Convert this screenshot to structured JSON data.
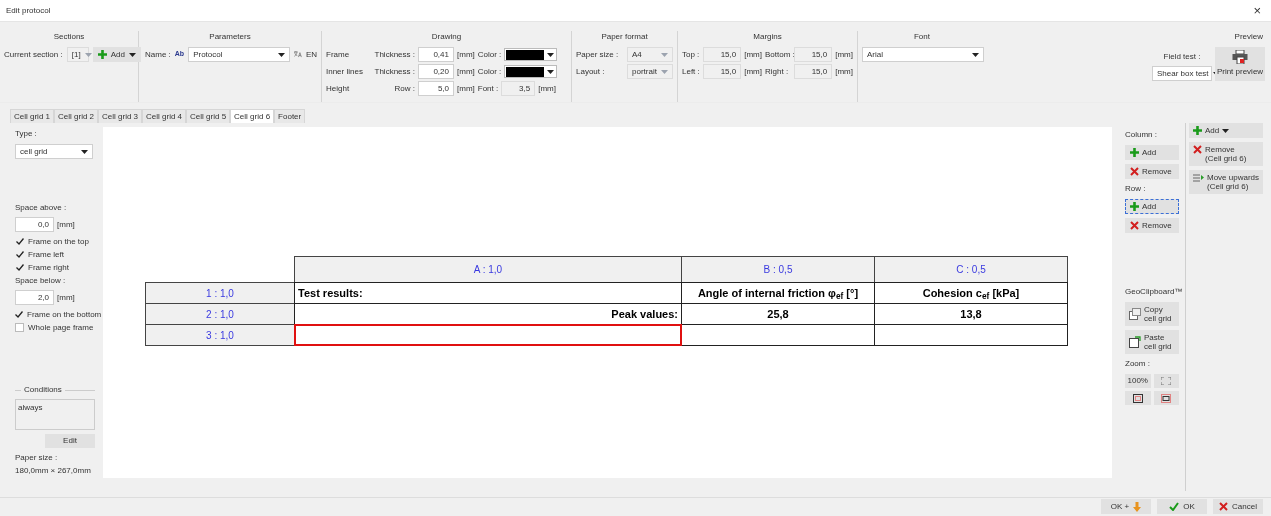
{
  "window": {
    "title": "Edit protocol",
    "close": "×"
  },
  "sections": {
    "title": "Sections",
    "current_label": "Current section :",
    "current_value": "[1]",
    "add": "Add"
  },
  "parameters": {
    "title": "Parameters",
    "name_label": "Name :",
    "style_icon": "Ab",
    "name_value": "Protocol",
    "language": "EN"
  },
  "drawing": {
    "title": "Drawing",
    "rows": [
      {
        "label": "Frame",
        "sub_label": "Thickness :",
        "value": "0,41",
        "unit": "[mm]",
        "extra_label": "Color :",
        "kind": "color",
        "color": "#000000"
      },
      {
        "label": "Inner lines",
        "sub_label": "Thickness :",
        "value": "0,20",
        "unit": "[mm]",
        "extra_label": "Color :",
        "kind": "color",
        "color": "#000000"
      },
      {
        "label": "Height",
        "sub_label": "Row :",
        "value": "5,0",
        "unit": "[mm]",
        "extra_label": "Font :",
        "kind": "value",
        "extra_value": "3,5",
        "extra_unit": "[mm]"
      }
    ]
  },
  "paper_format": {
    "title": "Paper format",
    "rows": [
      {
        "label": "Paper size :",
        "value": "A4"
      },
      {
        "label": "Layout :",
        "value": "portrait"
      }
    ]
  },
  "margins": {
    "title": "Margins",
    "rows": [
      {
        "label": "Top :",
        "value": "15,0",
        "unit": "[mm]",
        "label2": "Bottom :",
        "value2": "15,0",
        "unit2": "[mm]"
      },
      {
        "label": "Left :",
        "value": "15,0",
        "unit": "[mm]",
        "label2": "Right :",
        "value2": "15,0",
        "unit2": "[mm]"
      }
    ]
  },
  "font": {
    "title": "Font",
    "value": "Arial"
  },
  "preview": {
    "title": "Preview",
    "field_test_label": "Field test :",
    "field_test_value": "Shear box test",
    "print_preview": "Print preview"
  },
  "tabs": [
    {
      "label": "Cell grid 1",
      "selected": false
    },
    {
      "label": "Cell grid 2",
      "selected": false
    },
    {
      "label": "Cell grid 3",
      "selected": false
    },
    {
      "label": "Cell grid 4",
      "selected": false
    },
    {
      "label": "Cell grid 5",
      "selected": false
    },
    {
      "label": "Cell grid 6",
      "selected": true
    },
    {
      "label": "Footer",
      "selected": false
    }
  ],
  "left_panel": {
    "type_label": "Type :",
    "type_value": "cell grid",
    "space_above_label": "Space above :",
    "space_above_value": "0,0",
    "space_above_unit": "[mm]",
    "checks_top": [
      {
        "label": "Frame on the top",
        "checked": true
      },
      {
        "label": "Frame left",
        "checked": true
      },
      {
        "label": "Frame right",
        "checked": true
      }
    ],
    "space_below_label": "Space below :",
    "space_below_value": "2,0",
    "space_below_unit": "[mm]",
    "checks_bottom": [
      {
        "label": "Frame on the bottom",
        "checked": true
      },
      {
        "label": "Whole page frame",
        "checked": false
      }
    ],
    "conditions_title": "Conditions",
    "conditions_text": "always",
    "edit": "Edit",
    "paper_size_label": "Paper size :",
    "paper_size_value": "180,0mm × 267,0mm"
  },
  "grid": {
    "columns": [
      "A : 1,0",
      "B : 0,5",
      "C : 0,5"
    ],
    "rows": [
      {
        "header": "1 : 1,0",
        "cells": [
          {
            "text": "Test results:",
            "kind": "title",
            "selected": false
          },
          {
            "text": "Angle of internal friction φ$_{ef}$ [°]",
            "kind": "value",
            "selected": false
          },
          {
            "text": "Cohesion c$_{ef}$ [kPa]",
            "kind": "value",
            "selected": false
          }
        ]
      },
      {
        "header": "2 : 1,0",
        "cells": [
          {
            "text": "Peak values:",
            "kind": "label",
            "selected": false
          },
          {
            "text": "25,8",
            "kind": "value",
            "selected": false
          },
          {
            "text": "13,8",
            "kind": "value",
            "selected": false
          }
        ]
      },
      {
        "header": "3 : 1,0",
        "cells": [
          {
            "selected": true
          },
          {
            "selected": false
          },
          {
            "selected": false
          }
        ]
      }
    ]
  },
  "right_panel": {
    "column_label": "Column :",
    "column_buttons": [
      {
        "label": "Add",
        "kind": "add",
        "focused": false
      },
      {
        "label": "Remove",
        "kind": "remove",
        "focused": false
      }
    ],
    "row_label": "Row :",
    "row_buttons": [
      {
        "label": "Add",
        "kind": "add",
        "focused": true
      },
      {
        "label": "Remove",
        "kind": "remove",
        "focused": false
      }
    ],
    "clipboard_title": "GeoClipboard™",
    "clipboard_buttons": [
      {
        "label": "Copy",
        "detail": "cell grid",
        "kind": "copy"
      },
      {
        "label": "Paste",
        "detail": "cell grid",
        "kind": "paste"
      }
    ],
    "zoom_label": "Zoom :",
    "zoom_percent": "100%"
  },
  "side_actions": [
    {
      "label": "Add",
      "kind": "add-menu"
    },
    {
      "label": "Remove",
      "detail": "(Cell grid 6)",
      "kind": "remove"
    },
    {
      "label": "Move upwards",
      "detail": "(Cell grid 6)",
      "kind": "move"
    }
  ],
  "footer_buttons": [
    {
      "label": "OK +",
      "kind": "ok-plus"
    },
    {
      "label": "OK",
      "kind": "ok"
    },
    {
      "label": "Cancel",
      "kind": "cancel"
    }
  ]
}
